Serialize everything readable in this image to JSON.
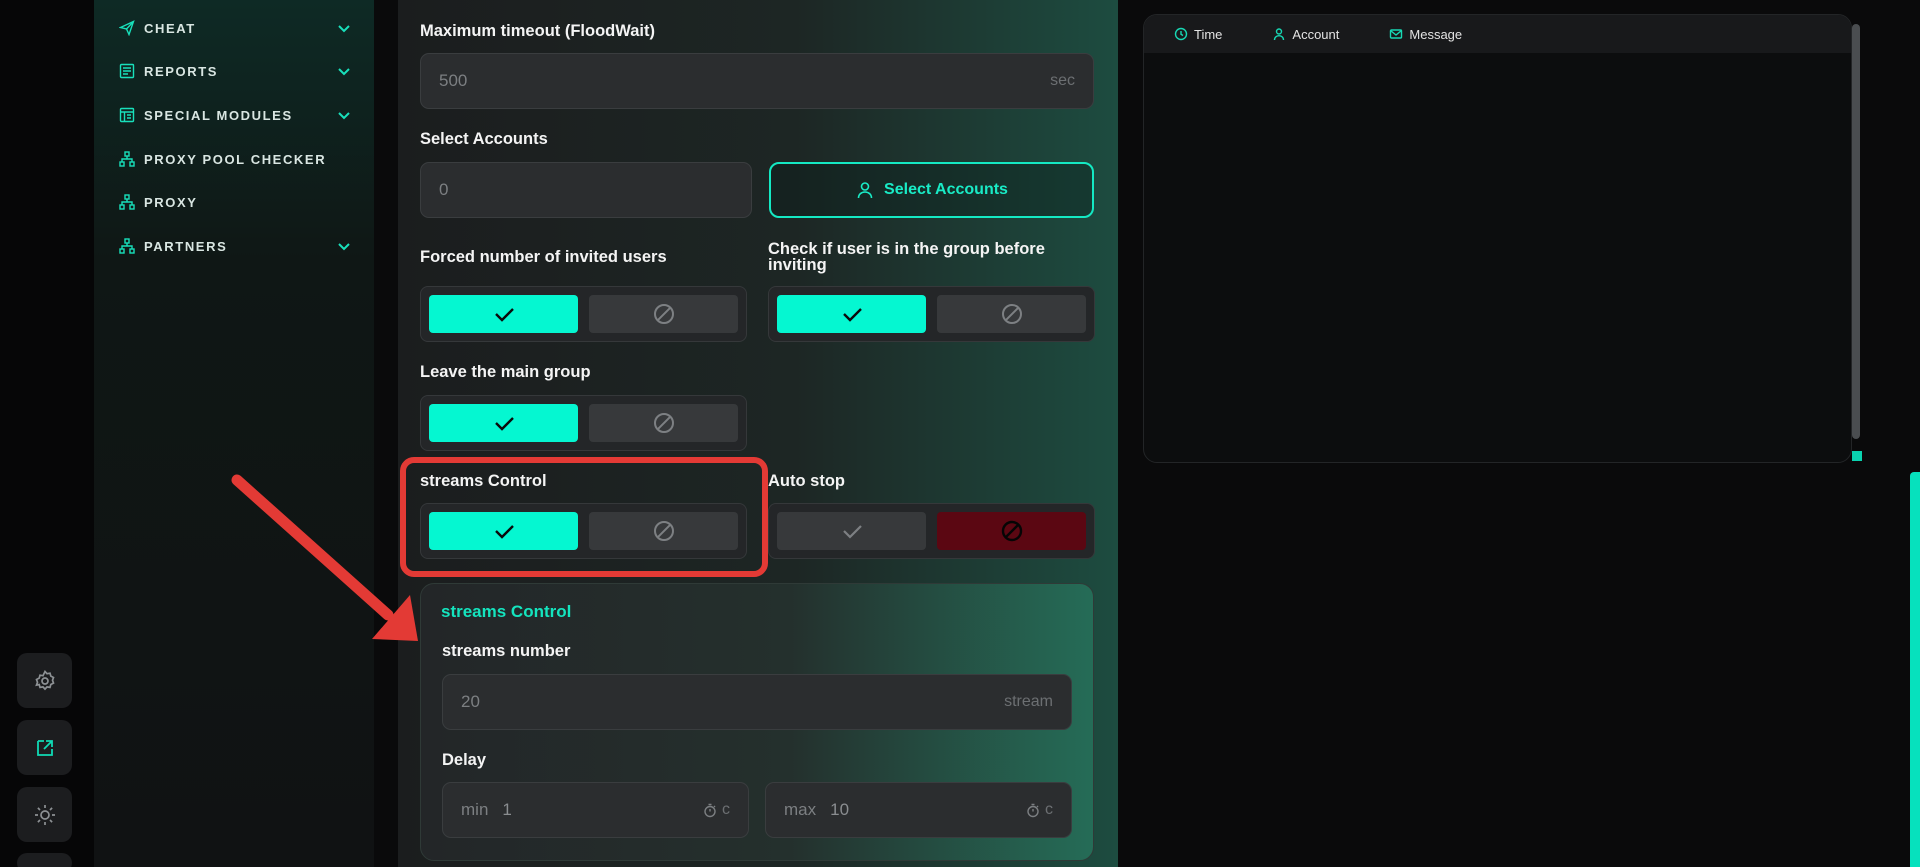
{
  "sidebar": {
    "items": [
      {
        "label": "CHEAT",
        "icon": "send-icon",
        "has_chevron": true
      },
      {
        "label": "REPORTS",
        "icon": "report-icon",
        "has_chevron": true
      },
      {
        "label": "SPECIAL MODULES",
        "icon": "modules-icon",
        "has_chevron": true
      },
      {
        "label": "PROXY POOL CHECKER",
        "icon": "network-icon",
        "has_chevron": false
      },
      {
        "label": "PROXY",
        "icon": "network-icon",
        "has_chevron": false
      },
      {
        "label": "PARTNERS",
        "icon": "network-icon",
        "has_chevron": true
      }
    ]
  },
  "rail": {
    "buttons": [
      "gear-icon",
      "external-link-icon",
      "sun-icon"
    ]
  },
  "form": {
    "max_timeout": {
      "label": "Maximum timeout (FloodWait)",
      "value": "500",
      "suffix": "sec"
    },
    "select_accounts": {
      "label": "Select Accounts",
      "value": "0",
      "button": "Select Accounts"
    },
    "forced_invited": {
      "label": "Forced number of invited users",
      "state": "yes"
    },
    "check_in_group": {
      "label": "Check if user is in the group before inviting",
      "state": "yes"
    },
    "leave_main_group": {
      "label": "Leave the main group",
      "state": "yes"
    },
    "streams_control": {
      "label": "streams Control",
      "state": "yes"
    },
    "auto_stop": {
      "label": "Auto stop",
      "state": "no"
    }
  },
  "streams_panel": {
    "title": "streams Control",
    "streams_number": {
      "label": "streams number",
      "value": "20",
      "suffix": "stream"
    },
    "delay": {
      "label": "Delay",
      "min": {
        "prefix": "min",
        "value": "1",
        "suffix": "c"
      },
      "max": {
        "prefix": "max",
        "value": "10",
        "suffix": "c"
      }
    }
  },
  "log": {
    "columns": [
      "Time",
      "Account",
      "Message"
    ]
  },
  "colors": {
    "accent": "#05f7d1",
    "highlight": "#e33a35",
    "stop": "#5b0712"
  }
}
